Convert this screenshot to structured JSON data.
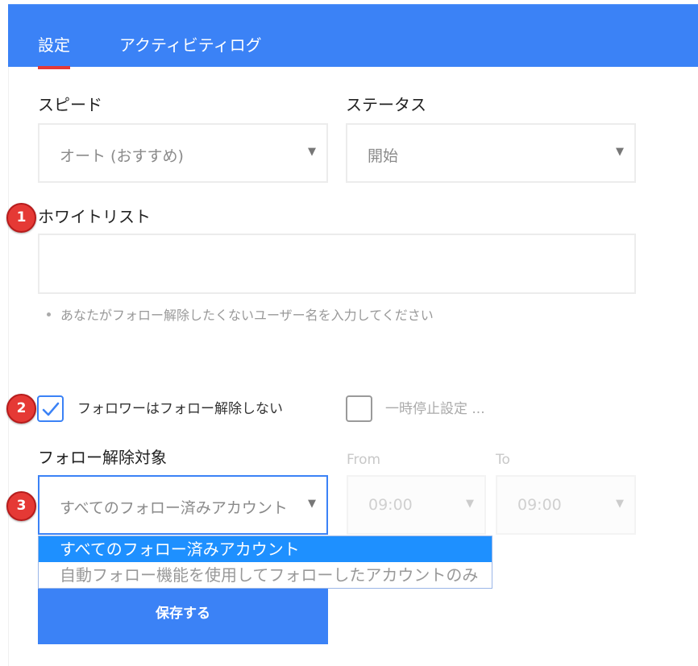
{
  "tabs": {
    "settings": "設定",
    "activity_log": "アクティビティログ"
  },
  "speed": {
    "label": "スピード",
    "value": "オート (おすすめ)"
  },
  "status": {
    "label": "ステータス",
    "value": "開始"
  },
  "whitelist": {
    "label": "ホワイトリスト",
    "value": "",
    "hint": "あなたがフォロー解除したくないユーザー名を入力してください"
  },
  "badges": [
    "1",
    "2",
    "3"
  ],
  "options": {
    "keep_followers_label": "フォロワーはフォロー解除しない",
    "keep_followers_checked": true,
    "pause_settings_label": "一時停止設定 ...",
    "pause_settings_checked": false
  },
  "unfollow_target": {
    "label": "フォロー解除対象",
    "value": "すべてのフォロー済みアカウント",
    "dropdown_options": [
      "すべてのフォロー済みアカウント",
      "自動フォロー機能を使用してフォローしたアカウントのみ"
    ],
    "selected_index": 0
  },
  "schedule": {
    "from_label": "From",
    "from_value": "09:00",
    "to_label": "To",
    "to_value": "09:00"
  },
  "save_label": "保存する",
  "colors": {
    "brand_blue": "#3b82f6",
    "active_tab_underline": "#e53935",
    "badge_red": "#e53935",
    "dropdown_highlight": "#1e90ff"
  }
}
